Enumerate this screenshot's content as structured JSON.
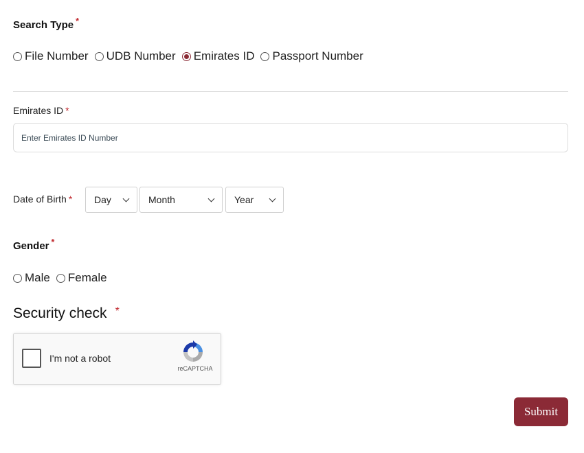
{
  "search_type": {
    "label": "Search Type",
    "required_mark": "*",
    "options": [
      {
        "label": "File Number",
        "checked": false
      },
      {
        "label": "UDB Number",
        "checked": false
      },
      {
        "label": "Emirates ID",
        "checked": true
      },
      {
        "label": "Passport Number",
        "checked": false
      }
    ]
  },
  "emirates_id": {
    "label": "Emirates ID",
    "required_mark": "*",
    "placeholder": "Enter Emirates ID Number",
    "value": ""
  },
  "date_of_birth": {
    "label": "Date of Birth",
    "required_mark": "*",
    "day": "Day",
    "month": "Month",
    "year": "Year"
  },
  "gender": {
    "label": "Gender",
    "required_mark": "*",
    "options": [
      {
        "label": "Male",
        "checked": false
      },
      {
        "label": "Female",
        "checked": false
      }
    ]
  },
  "security": {
    "title": "Security check",
    "required_mark": "*",
    "captcha_label": "I'm not a robot",
    "captcha_brand": "reCAPTCHA"
  },
  "submit_label": "Submit",
  "colors": {
    "accent": "#8b2a36",
    "required": "#c0272d"
  }
}
